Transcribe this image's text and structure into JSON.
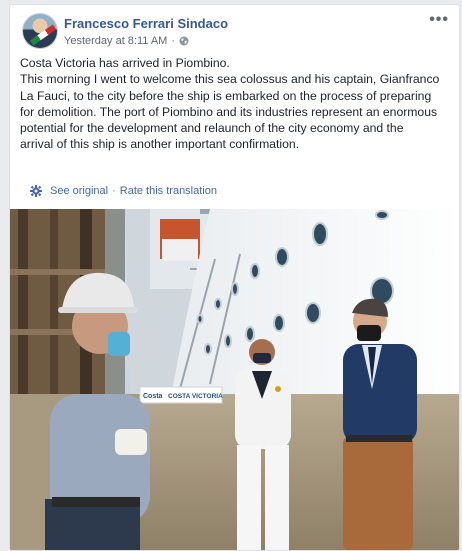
{
  "post": {
    "author": "Francesco Ferrari Sindaco",
    "timestamp": "Yesterday at 8:11 AM",
    "dot": "·",
    "privacy_icon": "globe-icon",
    "more_label": "•••",
    "text": [
      "Costa Victoria has arrived in Piombino.",
      "This morning I went to welcome this sea colossus and his captain, Gianfranco La Fauci, to the city before the ship is embarked on the process of preparing for demolition. The port of Piombino and its industries represent an enormous potential for the development and relaunch of the city economy and the arrival of this ship is another important confirmation."
    ],
    "translation": {
      "see_original": "See original",
      "separator": "·",
      "rate": "Rate this translation",
      "icon": "gear-icon"
    },
    "photo": {
      "ship_sign": "COSTA VICTORIA",
      "ship_logo": "Costa"
    }
  },
  "colors": {
    "link": "#365899",
    "accent": "#4267b2",
    "text": "#1d2129",
    "meta": "#616770",
    "background": "#e9ebee"
  }
}
